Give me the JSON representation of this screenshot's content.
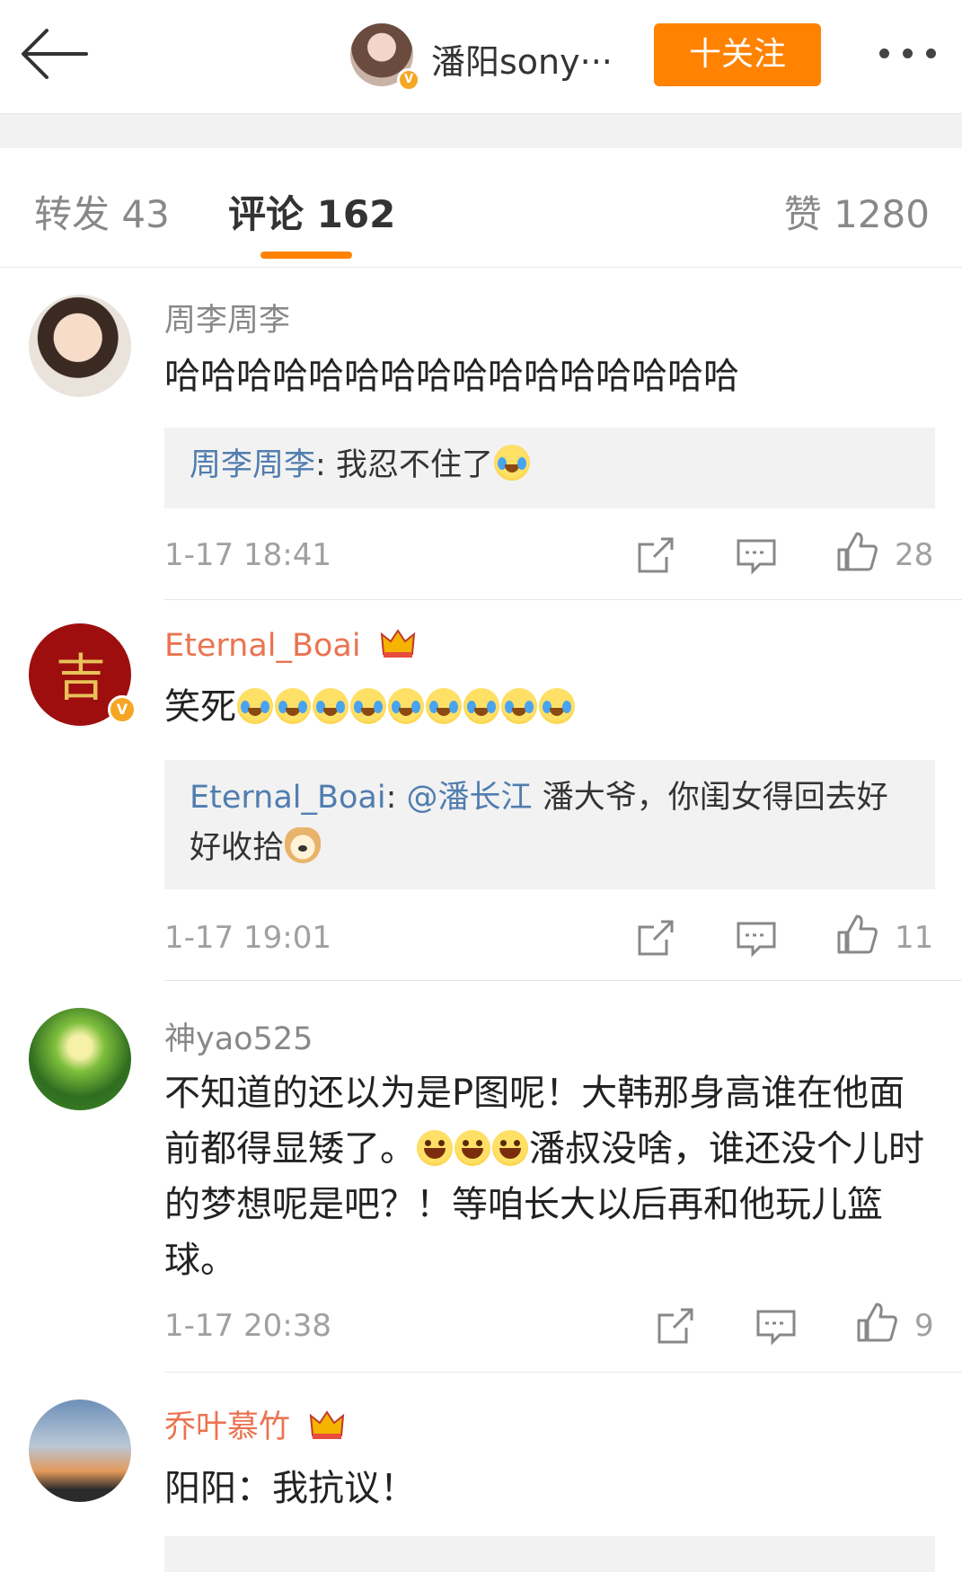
{
  "header": {
    "back_icon": "arrow-left-icon",
    "user_name": "潘阳sony···",
    "follow_label": "十关注",
    "more_icon": "more-dots-icon"
  },
  "tabs": {
    "repost": "转发 43",
    "comment": "评论 162",
    "like": "赞 1280"
  },
  "colors": {
    "accent": "#ff8200",
    "link": "#507daf",
    "vip": "#eb7350"
  },
  "comments": [
    {
      "name": "周李周李",
      "text": "哈哈哈哈哈哈哈哈哈哈哈哈哈哈哈哈",
      "reply_user": "周李周李",
      "reply_text": "我忍不住了",
      "time": "1-17 18:41",
      "likes": "28"
    },
    {
      "name": "Eternal_Boai",
      "text": "笑死",
      "reply_user": "Eternal_Boai",
      "reply_mention": "@潘长江",
      "reply_text": " 潘大爷，你闺女得回去好好收拾",
      "avatar_char": "吉",
      "time": "1-17 19:01",
      "likes": "11"
    },
    {
      "name": "神yao525",
      "text_a": "不知道的还以为是P图呢！大韩那身高谁在他面前都得显矮了。",
      "text_b": "潘叔没啥，谁还没个儿时的梦想呢是吧？！等咱长大以后再和他玩儿篮球。",
      "time": "1-17 20:38",
      "likes": "9"
    },
    {
      "name": "乔叶慕竹",
      "text": "阳阳：我抗议！"
    }
  ],
  "separator": ":",
  "verified_mark": "V"
}
